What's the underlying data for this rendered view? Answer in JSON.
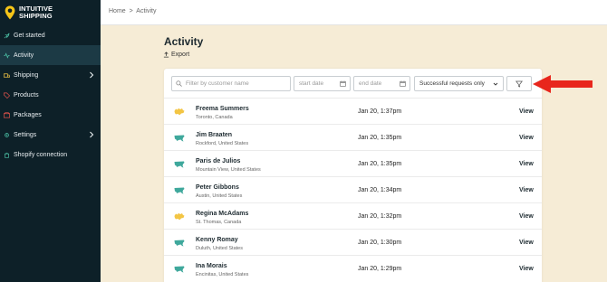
{
  "brand": {
    "line1": "INTUITIVE",
    "line2": "SHIPPING",
    "pin_color": "#f5c518"
  },
  "sidebar": {
    "items": [
      {
        "label": "Get started",
        "icon": "rocket-icon",
        "chevron": false
      },
      {
        "label": "Activity",
        "icon": "activity-icon",
        "chevron": false,
        "active": true
      },
      {
        "label": "Shipping",
        "icon": "truck-icon",
        "chevron": true
      },
      {
        "label": "Products",
        "icon": "tag-icon",
        "chevron": false
      },
      {
        "label": "Packages",
        "icon": "package-icon",
        "chevron": false
      },
      {
        "label": "Settings",
        "icon": "gear-icon",
        "chevron": true
      },
      {
        "label": "Shopify connection",
        "icon": "shopify-icon",
        "chevron": false
      }
    ]
  },
  "breadcrumb": {
    "home": "Home",
    "sep": ">",
    "current": "Activity"
  },
  "page": {
    "title": "Activity",
    "export_label": "Export"
  },
  "filters": {
    "search_placeholder": "Filter by customer name",
    "start_placeholder": "start date",
    "end_placeholder": "end date",
    "status_value": "Successful requests only"
  },
  "rows": [
    {
      "name": "Freema Summers",
      "location": "Toronto, Canada",
      "date": "Jan 20, 1:37pm",
      "action": "View",
      "flag": "canada"
    },
    {
      "name": "Jim Braaten",
      "location": "Rockford, United States",
      "date": "Jan 20, 1:35pm",
      "action": "View",
      "flag": "usa"
    },
    {
      "name": "Paris de Julios",
      "location": "Mountain View, United States",
      "date": "Jan 20, 1:35pm",
      "action": "View",
      "flag": "usa"
    },
    {
      "name": "Peter Gibbons",
      "location": "Austin, United States",
      "date": "Jan 20, 1:34pm",
      "action": "View",
      "flag": "usa"
    },
    {
      "name": "Regina McAdams",
      "location": "St. Thomas, Canada",
      "date": "Jan 20, 1:32pm",
      "action": "View",
      "flag": "canada"
    },
    {
      "name": "Kenny Romay",
      "location": "Duluth, United States",
      "date": "Jan 20, 1:30pm",
      "action": "View",
      "flag": "usa"
    },
    {
      "name": "Ina Morais",
      "location": "Encinitas, United States",
      "date": "Jan 20, 1:29pm",
      "action": "View",
      "flag": "usa"
    }
  ],
  "colors": {
    "sidebar_bg": "#0d2028",
    "sidebar_active": "#1c3a45",
    "page_bg": "#f6ecd6",
    "canada_icon": "#f3c544",
    "usa_icon": "#3fa89c",
    "arrow": "#e8261c"
  }
}
